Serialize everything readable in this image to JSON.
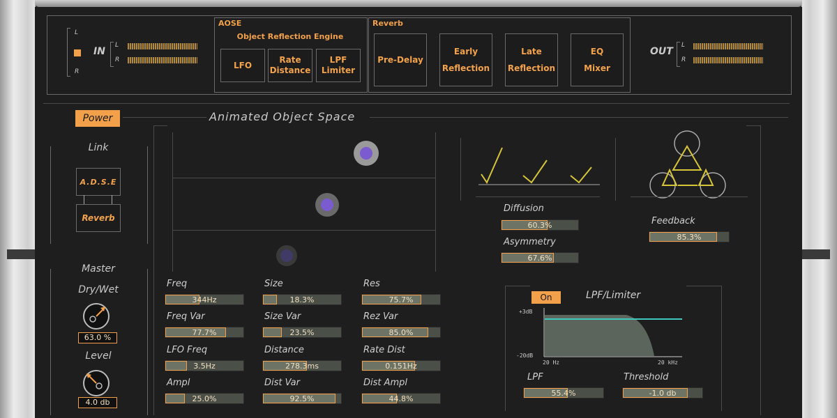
{
  "io": {
    "in_label": "IN",
    "out_label": "OUT",
    "left_channel": "L",
    "right_channel": "R"
  },
  "aose": {
    "tag": "AOSE",
    "title": "Object Reflection Engine",
    "buttons": [
      "LFO",
      "Rate\nDistance",
      "LPF\nLimiter"
    ]
  },
  "reverb": {
    "tag": "Reverb",
    "buttons": [
      "Pre-Delay",
      "Early\nReflection",
      "Late\nReflection",
      "EQ\nMixer"
    ]
  },
  "power_label": "Power",
  "space_title": "Animated Object Space",
  "link": {
    "title": "Link",
    "aose_label": "A.D.S.E",
    "reverb_label": "Reverb"
  },
  "master": {
    "title": "Master",
    "drywet_label": "Dry/Wet",
    "drywet_value": "63.0 %",
    "level_label": "Level",
    "level_value": "4.0 db"
  },
  "params": [
    {
      "label": "Freq",
      "value": "344Hz",
      "fill": 0.44
    },
    {
      "label": "Size",
      "value": "18.3%",
      "fill": 0.18
    },
    {
      "label": "Res",
      "value": "75.7%",
      "fill": 0.76
    },
    {
      "label": "Freq Var",
      "value": "77.7%",
      "fill": 0.78
    },
    {
      "label": "Size Var",
      "value": "23.5%",
      "fill": 0.24
    },
    {
      "label": "Rez Var",
      "value": "85.0%",
      "fill": 0.85
    },
    {
      "label": "LFO Freq",
      "value": "3.5Hz",
      "fill": 0.28
    },
    {
      "label": "Distance",
      "value": "278.3ms",
      "fill": 0.56
    },
    {
      "label": "Rate Dist",
      "value": "0.151Hz",
      "fill": 0.68
    },
    {
      "label": "Ampl",
      "value": "25.0%",
      "fill": 0.25
    },
    {
      "label": "Dist Var",
      "value": "92.5%",
      "fill": 0.93
    },
    {
      "label": "Dist Ampl",
      "value": "44.8%",
      "fill": 0.45
    }
  ],
  "diffusion": {
    "label": "Diffusion",
    "value": "60.3%",
    "fill": 0.6
  },
  "asymmetry": {
    "label": "Asymmetry",
    "value": "67.6%",
    "fill": 0.68
  },
  "feedback": {
    "label": "Feedback",
    "value": "85.3%",
    "fill": 0.85
  },
  "lpf_section": {
    "title": "LPF/Limiter",
    "on_label": "On",
    "top_db": "+3dB",
    "bottom_db": "-20dB",
    "freq_low": "20 Hz",
    "freq_high": "20 kHz"
  },
  "lpf": {
    "label": "LPF",
    "value": "55.4%",
    "fill": 0.55
  },
  "threshold": {
    "label": "Threshold",
    "value": "-1.0 db",
    "fill": 0.82
  },
  "colors": {
    "accent": "#f2a04a",
    "accent_line": "#d6c43a",
    "limiter_line": "#3fc7c0",
    "object_purple": "#7a5bd0"
  }
}
